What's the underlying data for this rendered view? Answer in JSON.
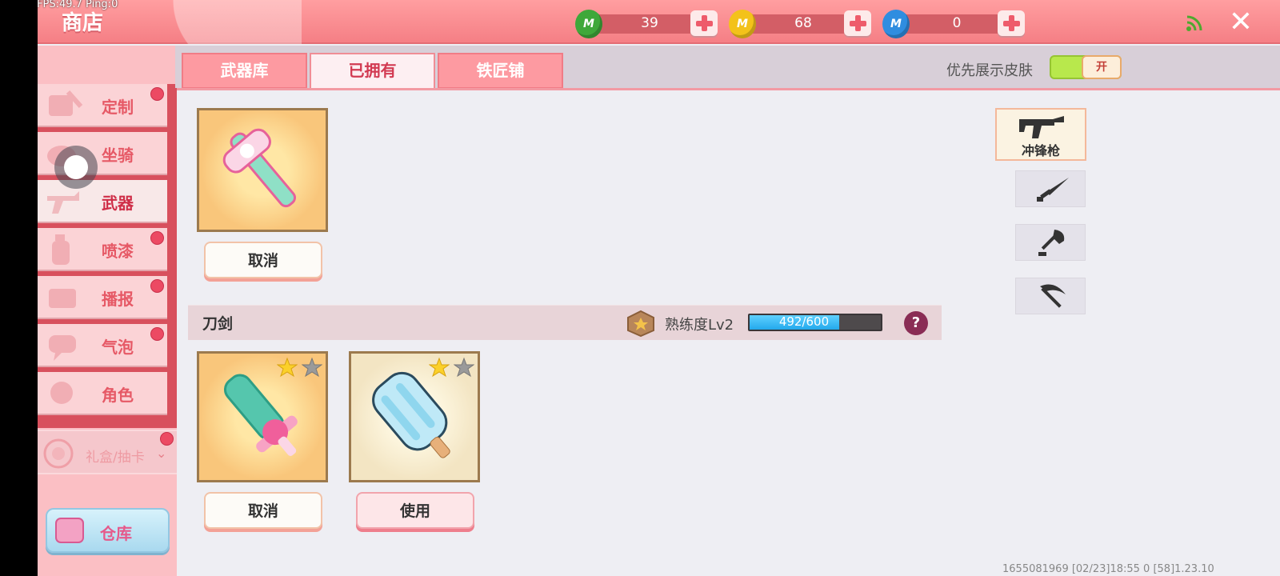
{
  "overlay": {
    "fps": "FPS:49.7  Ping:0"
  },
  "header": {
    "title": "商店",
    "currencies": [
      {
        "icon": "green-gem-icon",
        "letter": "M",
        "value": "39",
        "color": "#3fa83a"
      },
      {
        "icon": "gold-coin-icon",
        "letter": "M",
        "value": "68",
        "color": "#f3c21a"
      },
      {
        "icon": "blue-coin-icon",
        "letter": "M",
        "value": "0",
        "color": "#2f8de0"
      }
    ],
    "close_symbol": "✕"
  },
  "sidebar": {
    "items": [
      {
        "label": "定制",
        "icon": "custom-icon",
        "badge": true
      },
      {
        "label": "坐骑",
        "icon": "mount-icon",
        "badge": false
      },
      {
        "label": "武器",
        "icon": "weapon-icon",
        "badge": false,
        "active": true
      },
      {
        "label": "喷漆",
        "icon": "spray-icon",
        "badge": true
      },
      {
        "label": "播报",
        "icon": "broadcast-icon",
        "badge": true
      },
      {
        "label": "气泡",
        "icon": "bubble-icon",
        "badge": true
      },
      {
        "label": "角色",
        "icon": "character-icon",
        "badge": false
      }
    ],
    "gift_label": "礼盒/抽卡",
    "gift_chevron": "⌄",
    "warehouse_label": "仓库"
  },
  "tabs": [
    {
      "label": "武器库",
      "active": false
    },
    {
      "label": "已拥有",
      "active": true
    },
    {
      "label": "铁匠铺",
      "active": false
    }
  ],
  "skin_toggle": {
    "label": "优先展示皮肤",
    "state": "开"
  },
  "main": {
    "top_item": {
      "button": "取消"
    },
    "section": {
      "title": "刀剑",
      "mastery_label": "熟练度Lv2",
      "progress_text": "492/600",
      "progress_value": 492,
      "progress_max": 600,
      "help": "?"
    },
    "items": [
      {
        "stars_filled": 1,
        "stars_total": 2,
        "button": "取消",
        "button_style": "white"
      },
      {
        "stars_filled": 1,
        "stars_total": 2,
        "button": "使用",
        "button_style": "pink"
      }
    ]
  },
  "categories": [
    {
      "label": "冲锋枪",
      "icon": "submachine-gun-icon",
      "active": true
    },
    {
      "label": "",
      "icon": "sword-icon",
      "active": false
    },
    {
      "label": "",
      "icon": "shovel-icon",
      "active": false
    },
    {
      "label": "",
      "icon": "pickaxe-icon",
      "active": false
    }
  ],
  "footer": {
    "text": "1655081969   [02/23]18:55 0   [58]1.23.10"
  }
}
